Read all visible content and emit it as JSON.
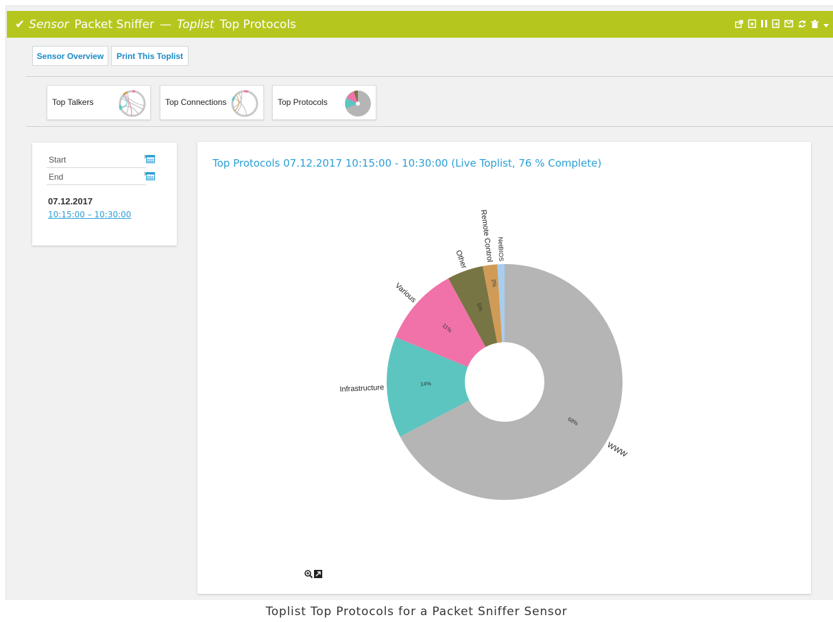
{
  "header": {
    "check_icon": "check-icon",
    "sensor_label": "Sensor",
    "sensor_name": "Packet Sniffer",
    "separator": "—",
    "toplist_label": "Toplist",
    "toplist_name": "Top Protocols",
    "color": "#b5c71f",
    "icons": [
      "external-link-icon",
      "pdf-icon",
      "pause-icon",
      "export-icon",
      "email-icon",
      "refresh-icon",
      "trash-icon",
      "chevron-down-icon"
    ]
  },
  "toolbar": {
    "sensor_overview": "Sensor Overview",
    "print_toplist": "Print This Toplist"
  },
  "tiles": [
    {
      "label": "Top Talkers"
    },
    {
      "label": "Top Connections"
    },
    {
      "label": "Top Protocols"
    }
  ],
  "filter": {
    "start_placeholder": "Start",
    "end_placeholder": "End",
    "clear_symbol": "×",
    "date": "07.12.2017",
    "time_range": "10:15:00 – 10:30:00"
  },
  "chart_title": "Top Protocols 07.12.2017 10:15:00 - 10:30:00 (Live Toplist, 76 % Complete)",
  "chart_data": {
    "type": "pie",
    "title": "Top Protocols 07.12.2017 10:15:00 - 10:30:00 (Live Toplist, 76 % Complete)",
    "slices": [
      {
        "label": "WWW",
        "value": 68,
        "pct_label": "68%",
        "color": "#b5b5b5"
      },
      {
        "label": "Infrastructure",
        "value": 14,
        "pct_label": "14%",
        "color": "#5cc5bf"
      },
      {
        "label": "Various",
        "value": 11,
        "pct_label": "11%",
        "color": "#f072a9"
      },
      {
        "label": "Other",
        "value": 5,
        "pct_label": "5%",
        "color": "#777543"
      },
      {
        "label": "Remote Control",
        "value": 2,
        "pct_label": "2%",
        "color": "#d09b57"
      },
      {
        "label": "NetBIOS",
        "value": 1,
        "pct_label": "",
        "color": "#a9cdee"
      }
    ]
  },
  "chart_controls": [
    "zoom-icon",
    "expand-icon"
  ],
  "caption": "Toplist Top Protocols for a Packet Sniffer Sensor"
}
